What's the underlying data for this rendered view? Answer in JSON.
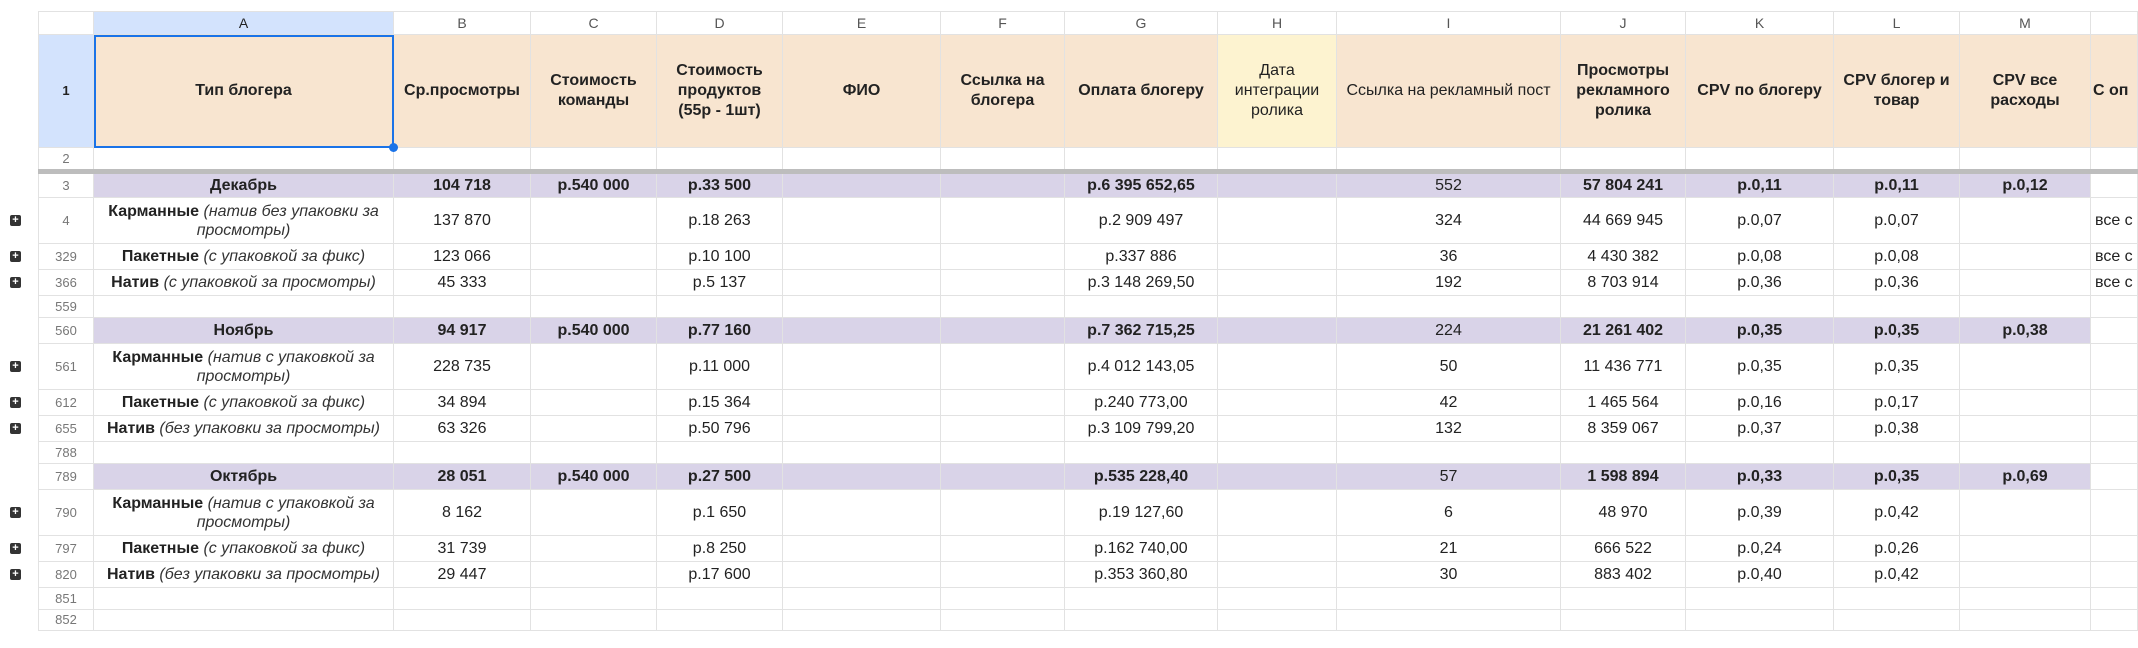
{
  "columns": [
    "",
    "A",
    "B",
    "C",
    "D",
    "E",
    "F",
    "G",
    "H",
    "I",
    "J",
    "K",
    "L",
    "M",
    ""
  ],
  "header_row": {
    "num": "1",
    "cells": [
      "Тип блогера",
      "Ср.просмотры",
      "Стоимость команды",
      "Стоимость продуктов (55р - 1шт)",
      "ФИО",
      "Ссылка на блогера",
      "Оплата блогеру",
      "Дата интеграции ролика",
      "Ссылка на рекламный пост",
      "Просмотры рекламного ролика",
      "CPV по блогеру",
      "CPV блогер и товар",
      "CPV все расходы",
      "С оп"
    ]
  },
  "rows": [
    {
      "num": "2",
      "type": "empty"
    },
    {
      "num": "3",
      "type": "month",
      "cells": [
        "Декабрь",
        "104 718",
        "р.540 000",
        "р.33 500",
        "",
        "",
        "р.6 395 652,65",
        "",
        "552",
        "57 804 241",
        "р.0,11",
        "р.0,11",
        "р.0,12",
        ""
      ]
    },
    {
      "num": "4",
      "type": "sub",
      "bold": "Карманные",
      "italic": "(натив без упаковки за просмотры)",
      "cells": [
        "137 870",
        "",
        "р.18 263",
        "",
        "",
        "р.2 909 497",
        "",
        "324",
        "44 669 945",
        "р.0,07",
        "р.0,07",
        "",
        "все с"
      ]
    },
    {
      "num": "329",
      "type": "sub",
      "bold": "Пакетные",
      "italic": "(с упаковкой за фикс)",
      "cells": [
        "123 066",
        "",
        "р.10 100",
        "",
        "",
        "р.337 886",
        "",
        "36",
        "4 430 382",
        "р.0,08",
        "р.0,08",
        "",
        "все с"
      ]
    },
    {
      "num": "366",
      "type": "sub",
      "bold": "Натив",
      "italic": "(с упаковкой за просмотры)",
      "cells": [
        "45 333",
        "",
        "р.5 137",
        "",
        "",
        "р.3 148 269,50",
        "",
        "192",
        "8 703 914",
        "р.0,36",
        "р.0,36",
        "",
        "все с"
      ]
    },
    {
      "num": "559",
      "type": "empty"
    },
    {
      "num": "560",
      "type": "month",
      "cells": [
        "Ноябрь",
        "94 917",
        "р.540 000",
        "р.77 160",
        "",
        "",
        "р.7 362 715,25",
        "",
        "224",
        "21 261 402",
        "р.0,35",
        "р.0,35",
        "р.0,38",
        ""
      ]
    },
    {
      "num": "561",
      "type": "sub",
      "bold": "Карманные",
      "italic": "(натив с упаковкой за просмотры)",
      "cells": [
        "228 735",
        "",
        "р.11 000",
        "",
        "",
        "р.4 012 143,05",
        "",
        "50",
        "11 436 771",
        "р.0,35",
        "р.0,35",
        "",
        ""
      ]
    },
    {
      "num": "612",
      "type": "sub",
      "bold": "Пакетные",
      "italic": "(с упаковкой за фикс)",
      "cells": [
        "34 894",
        "",
        "р.15 364",
        "",
        "",
        "р.240 773,00",
        "",
        "42",
        "1 465 564",
        "р.0,16",
        "р.0,17",
        "",
        ""
      ]
    },
    {
      "num": "655",
      "type": "sub",
      "bold": "Натив",
      "italic": "(без упаковки за просмотры)",
      "cells": [
        "63 326",
        "",
        "р.50 796",
        "",
        "",
        "р.3 109 799,20",
        "",
        "132",
        "8 359 067",
        "р.0,37",
        "р.0,38",
        "",
        ""
      ]
    },
    {
      "num": "788",
      "type": "empty"
    },
    {
      "num": "789",
      "type": "month",
      "cells": [
        "Октябрь",
        "28 051",
        "р.540 000",
        "р.27 500",
        "",
        "",
        "р.535 228,40",
        "",
        "57",
        "1 598 894",
        "р.0,33",
        "р.0,35",
        "р.0,69",
        ""
      ]
    },
    {
      "num": "790",
      "type": "sub",
      "bold": "Карманные",
      "italic": "(натив с упаковкой за просмотры)",
      "cells": [
        "8 162",
        "",
        "р.1 650",
        "",
        "",
        "р.19 127,60",
        "",
        "6",
        "48 970",
        "р.0,39",
        "р.0,42",
        "",
        ""
      ]
    },
    {
      "num": "797",
      "type": "sub",
      "bold": "Пакетные",
      "italic": "(с упаковкой за фикс)",
      "cells": [
        "31 739",
        "",
        "р.8 250",
        "",
        "",
        "р.162 740,00",
        "",
        "21",
        "666 522",
        "р.0,24",
        "р.0,26",
        "",
        ""
      ]
    },
    {
      "num": "820",
      "type": "sub",
      "bold": "Натив",
      "italic": "(без упаковки за просмотры)",
      "cells": [
        "29 447",
        "",
        "р.17 600",
        "",
        "",
        "р.353 360,80",
        "",
        "30",
        "883 402",
        "р.0,40",
        "р.0,42",
        "",
        ""
      ]
    },
    {
      "num": "851",
      "type": "empty"
    },
    {
      "num": "852",
      "type": "empty"
    }
  ],
  "colors": {
    "header_bg": "#f8e5d0",
    "date_header_bg": "#fdf3d0",
    "month_bg": "#d9d3e8",
    "selection": "#1a73e8"
  }
}
